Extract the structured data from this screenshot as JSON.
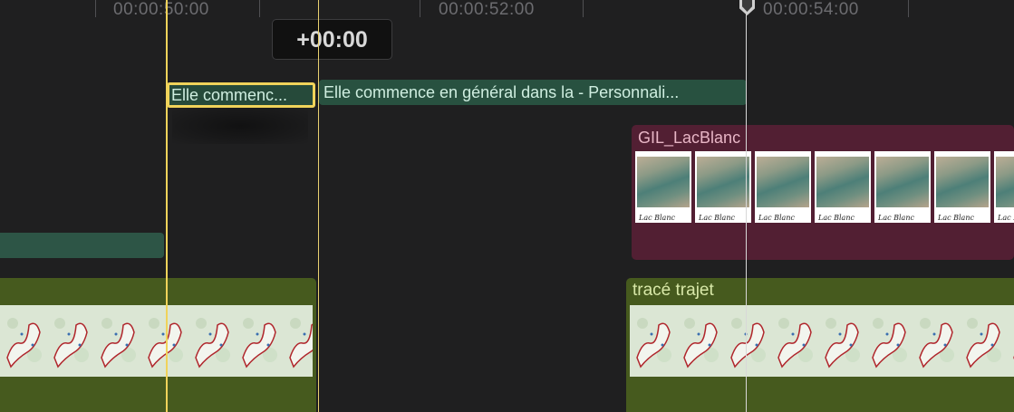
{
  "ruler": {
    "timecodes": [
      "00:00:50:00",
      "00:00:52:00",
      "00:00:54:00"
    ]
  },
  "skimmer": {
    "delta": "+00:00"
  },
  "titles": {
    "selected_title": "Elle commenc...",
    "title_b": "Elle commence en général dans la  - Personnali..."
  },
  "clips": {
    "lacblanc": {
      "name": "GIL_LacBlanc",
      "thumb_caption": "Lac Blanc"
    },
    "trace": {
      "name": "tracé trajet"
    }
  },
  "colors": {
    "background": "#1f1f20",
    "selection_yellow": "#f0d35a",
    "title_green": "#285140",
    "video_red": "#521f33",
    "video_olive": "#465a1e"
  }
}
